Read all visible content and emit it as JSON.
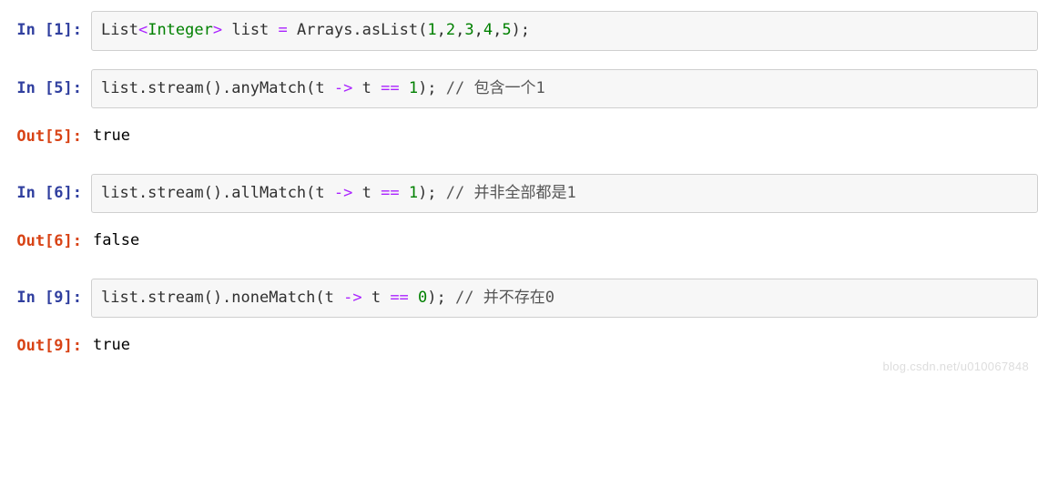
{
  "cells": [
    {
      "prompt_in": "In [1]:",
      "code": {
        "pre1": "List",
        "lt": "<",
        "generic": "Integer",
        "gt": ">",
        "mid1": " list ",
        "eq": "=",
        "mid2": " Arrays.asList(",
        "n1": "1",
        "c1": ",",
        "n2": "2",
        "c2": ",",
        "n3": "3",
        "c3": ",",
        "n4": "4",
        "c4": ",",
        "n5": "5",
        "tail": ");"
      }
    },
    {
      "prompt_in": "In [5]:",
      "code": {
        "pre": "list.stream().anyMatch(t ",
        "arrow": "->",
        "mid": " t ",
        "eqeq": "==",
        "sp": " ",
        "num": "1",
        "tail": "); ",
        "comment": "// 包含一个1"
      },
      "prompt_out": "Out[5]:",
      "output": "true"
    },
    {
      "prompt_in": "In [6]:",
      "code": {
        "pre": "list.stream().allMatch(t ",
        "arrow": "->",
        "mid": " t ",
        "eqeq": "==",
        "sp": " ",
        "num": "1",
        "tail": "); ",
        "comment": "// 并非全部都是1"
      },
      "prompt_out": "Out[6]:",
      "output": "false"
    },
    {
      "prompt_in": "In [9]:",
      "code": {
        "pre": "list.stream().noneMatch(t ",
        "arrow": "->",
        "mid": " t ",
        "eqeq": "==",
        "sp": " ",
        "num": "0",
        "tail": "); ",
        "comment": "// 并不存在0"
      },
      "prompt_out": "Out[9]:",
      "output": "true"
    }
  ],
  "watermark": "blog.csdn.net/u010067848"
}
